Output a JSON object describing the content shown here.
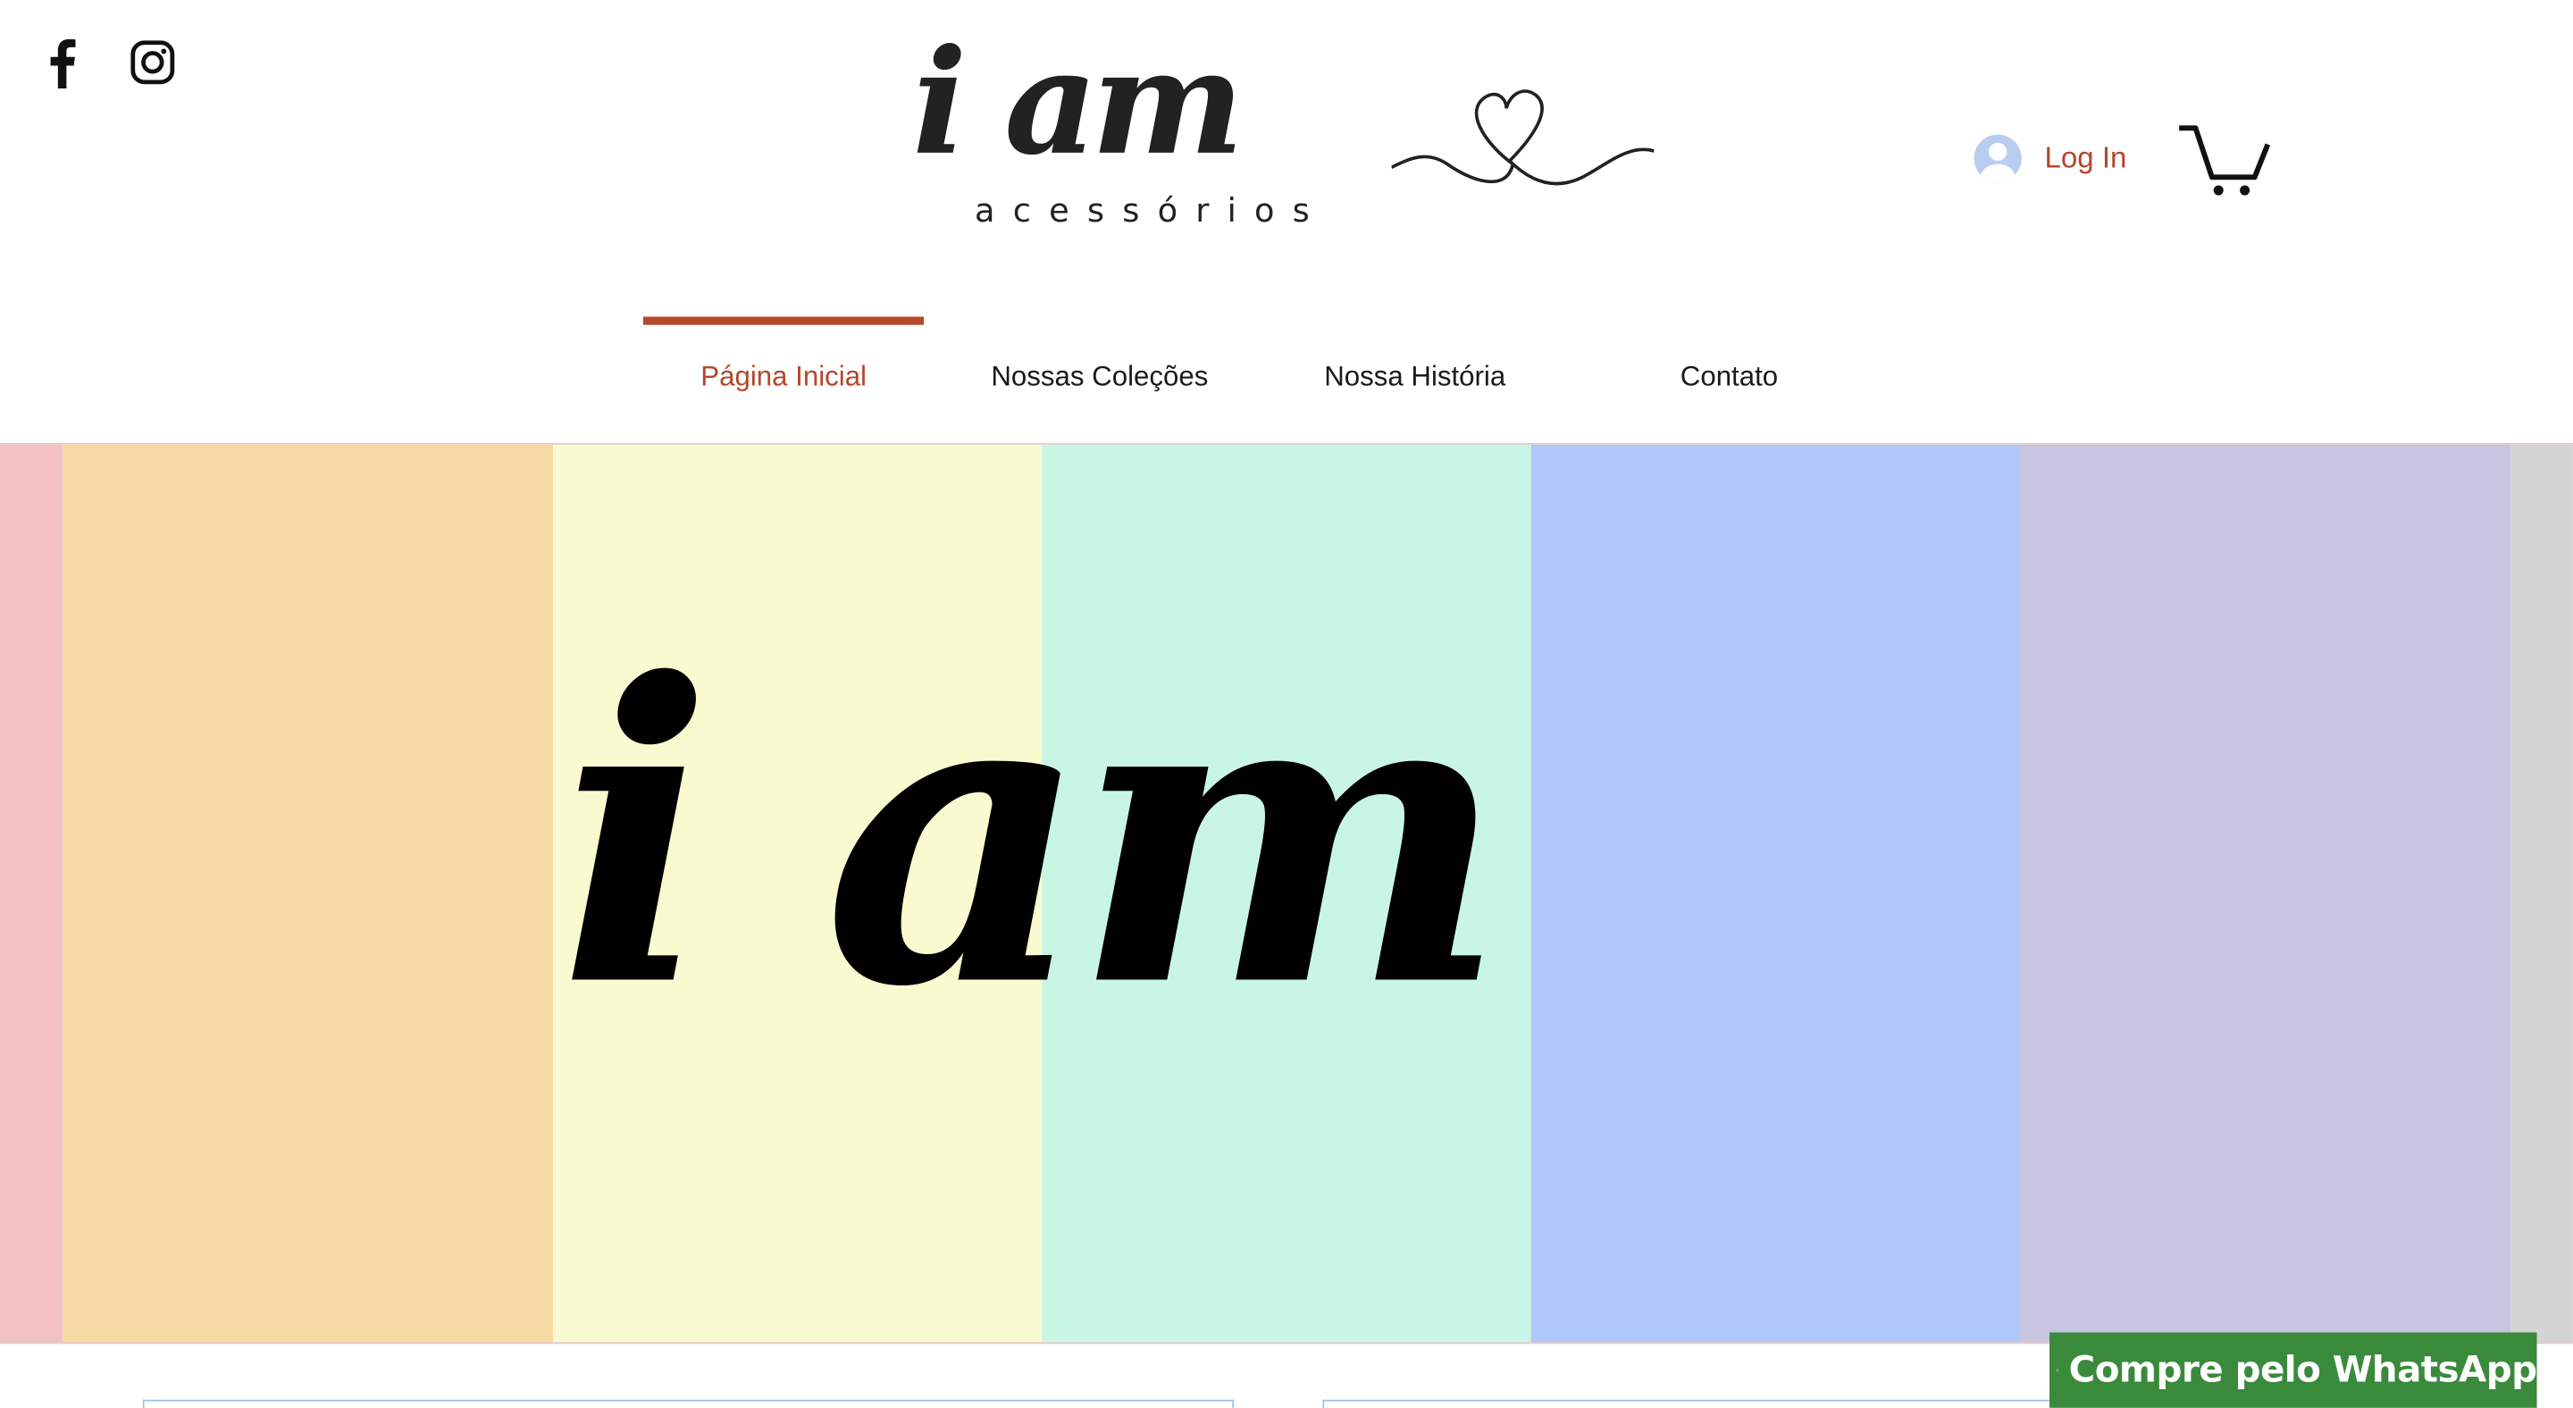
{
  "header": {
    "logo": {
      "wordmark": "i am",
      "subtitle": "acessórios"
    },
    "social": [
      {
        "name": "facebook-icon"
      },
      {
        "name": "instagram-icon"
      }
    ],
    "login_label": "Log In",
    "colors": {
      "accent": "#b5472b",
      "text": "#1a1a1a"
    }
  },
  "nav": {
    "items": [
      {
        "label": "Página Inicial",
        "active": true
      },
      {
        "label": "Nossas Coleções",
        "active": false
      },
      {
        "label": "Nossa História",
        "active": false
      },
      {
        "label": "Contato",
        "active": false
      }
    ]
  },
  "hero": {
    "text": "i am",
    "stripes": [
      "#f2c2c3",
      "#f7d9a4",
      "#f8fbcf",
      "#c9f6e4",
      "#afcaf8",
      "#c8c5e1",
      "#d4d4d4"
    ]
  },
  "whatsapp": {
    "label": "Compre pelo WhatsApp",
    "color": "#3a8a3c"
  }
}
